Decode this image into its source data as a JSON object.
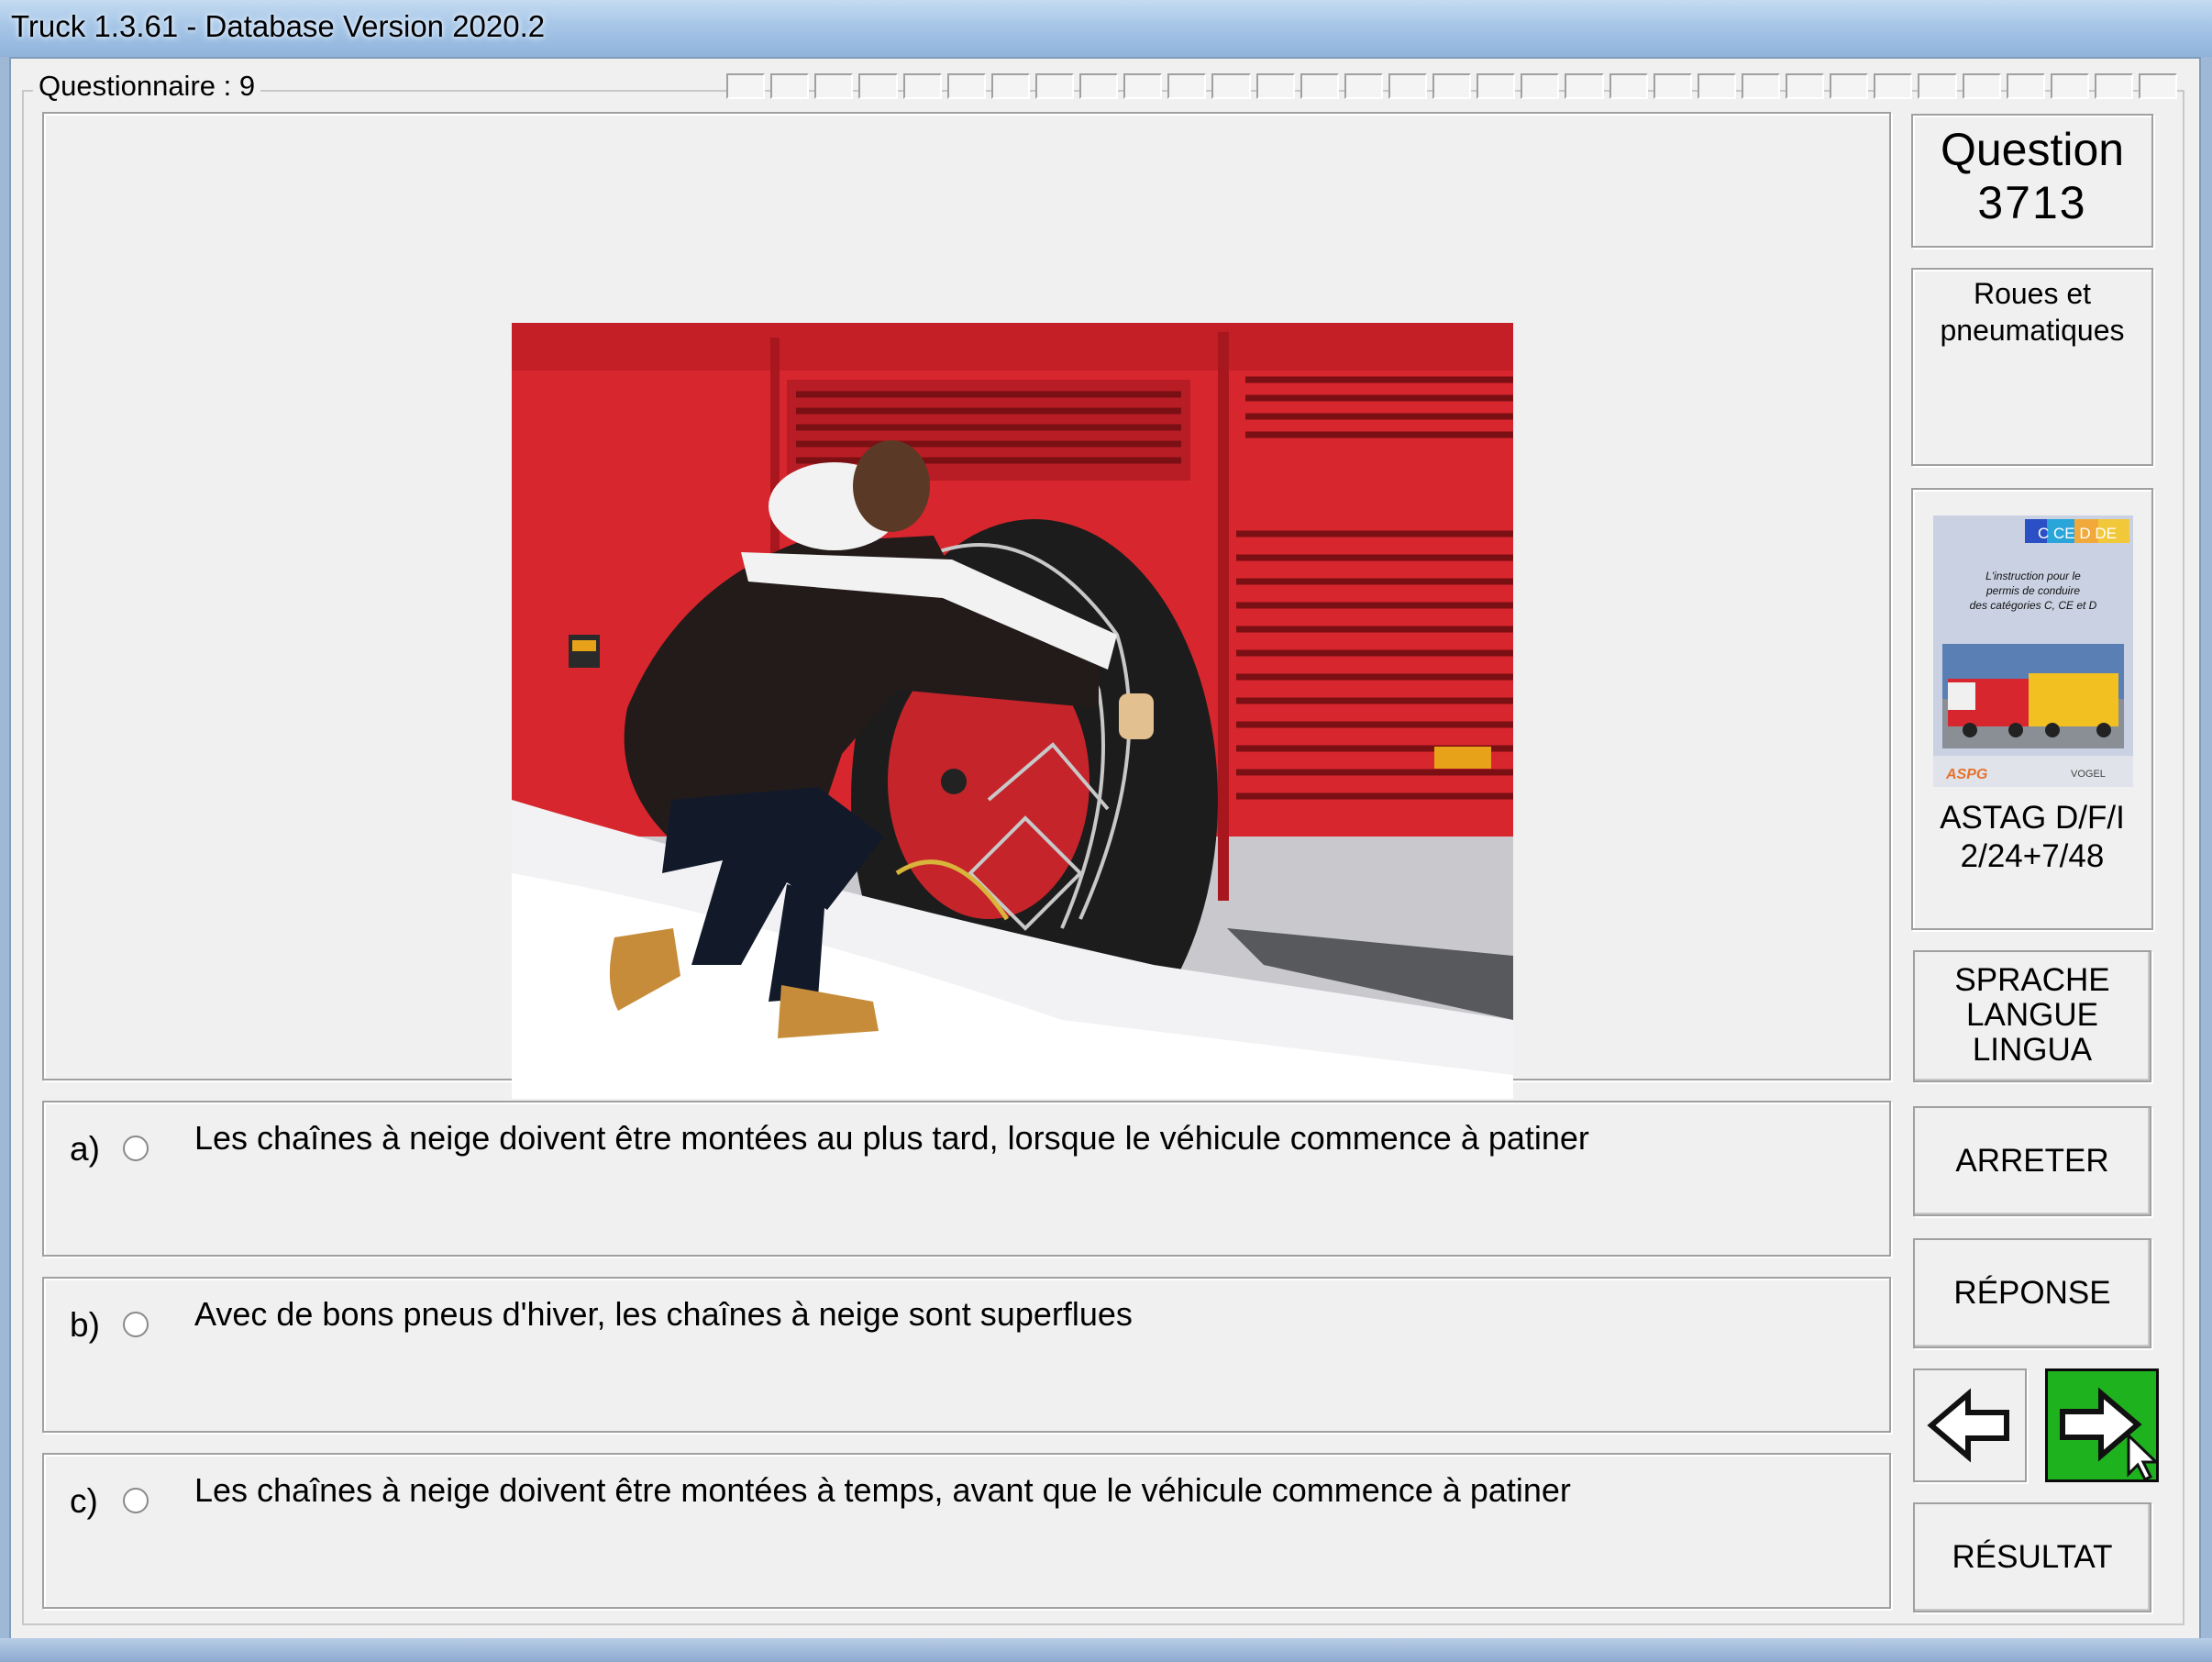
{
  "window": {
    "title": "Truck 1.3.61 - Database Version 2020.2"
  },
  "questionnaire": {
    "label": "Questionnaire : 9",
    "progress_cells": 33
  },
  "question": {
    "label": "Question",
    "number": "3713"
  },
  "category": {
    "line1": "Roues et",
    "line2": "pneumatiques"
  },
  "book": {
    "cover_badge": "C CE D DE",
    "cover_text": [
      "L'instruction pour le",
      "permis de conduire",
      "des catégories C, CE et D"
    ],
    "line1": "ASTAG D/F/I",
    "line2": "2/24+7/48"
  },
  "answers": [
    {
      "letter": "a)",
      "text": "Les chaînes à neige doivent être montées au plus tard, lorsque le véhicule commence à patiner"
    },
    {
      "letter": "b)",
      "text": "Avec de bons pneus d'hiver, les chaînes à neige sont superflues"
    },
    {
      "letter": "c)",
      "text": "Les chaînes à neige doivent être montées à temps, avant que le véhicule commence à patiner"
    }
  ],
  "buttons": {
    "language": [
      "SPRACHE",
      "LANGUE",
      "LINGUA"
    ],
    "stop": "ARRETER",
    "answer": "RÉPONSE",
    "result": "RÉSULTAT",
    "back_icon": "arrow-left-icon",
    "next_icon": "arrow-right-icon"
  },
  "colors": {
    "next_button": "#1fb21f",
    "bus_red": "#d8262e"
  }
}
